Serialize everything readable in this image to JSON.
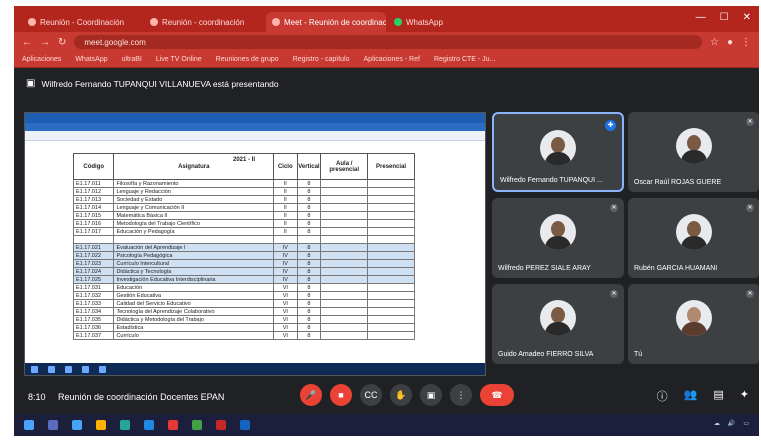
{
  "browser": {
    "tabs": [
      {
        "title": "Reunión - Coordinación",
        "active": false
      },
      {
        "title": "Reunión - coordinación",
        "active": false
      },
      {
        "title": "Meet - Reunión de coordinación",
        "active": true
      },
      {
        "title": "WhatsApp",
        "active": false
      }
    ],
    "url": "meet.google.com",
    "bookmarks": [
      "Aplicaciones",
      "WhatsApp",
      "ultraBI",
      "Live TV Online",
      "Reuniones de grupo",
      "Registro - capítulo",
      "Aplicaciones - Ref",
      "Registro CTE - Ju..."
    ]
  },
  "presenter_text": "Wilfredo Fernando TUPANQUI VILLANUEVA está presentando",
  "shared_doc": {
    "period": "2021 - II",
    "headers": [
      "Código",
      "Asignatura",
      "Ciclo",
      "Vertical",
      "Aula / presencial",
      "Presencial"
    ],
    "rows": [
      {
        "code": "E1.17.011",
        "subject": "Filosofía y Razonamiento",
        "ciclo": "II",
        "val": "8",
        "hl": false
      },
      {
        "code": "E1.17.012",
        "subject": "Lenguaje y Redacción",
        "ciclo": "II",
        "val": "8",
        "hl": false
      },
      {
        "code": "E1.17.013",
        "subject": "Sociedad y Estado",
        "ciclo": "II",
        "val": "8",
        "hl": false
      },
      {
        "code": "E1.17.014",
        "subject": "Lenguaje y Comunicación II",
        "ciclo": "II",
        "val": "8",
        "hl": false
      },
      {
        "code": "E1.17.015",
        "subject": "Matemática Básica II",
        "ciclo": "II",
        "val": "8",
        "hl": false
      },
      {
        "code": "E1.17.016",
        "subject": "Metodología del Trabajo Científico",
        "ciclo": "II",
        "val": "8",
        "hl": false
      },
      {
        "code": "E1.17.017",
        "subject": "Educación y Pedagogía",
        "ciclo": "II",
        "val": "8",
        "hl": false
      },
      {
        "code": "",
        "subject": "",
        "ciclo": "",
        "val": "",
        "hl": false
      },
      {
        "code": "E1.17.021",
        "subject": "Evaluación del Aprendizaje I",
        "ciclo": "IV",
        "val": "8",
        "hl": true
      },
      {
        "code": "E1.17.022",
        "subject": "Psicología Pedagógica",
        "ciclo": "IV",
        "val": "8",
        "hl": true
      },
      {
        "code": "E1.17.023",
        "subject": "Currículo Intercultural",
        "ciclo": "IV",
        "val": "8",
        "hl": true
      },
      {
        "code": "E1.17.024",
        "subject": "Didáctica y Tecnología",
        "ciclo": "IV",
        "val": "8",
        "hl": true
      },
      {
        "code": "E1.17.025",
        "subject": "Investigación Educativa Interdisciplinaria",
        "ciclo": "IV",
        "val": "8",
        "hl": true
      },
      {
        "code": "E1.17.031",
        "subject": "Educación",
        "ciclo": "VI",
        "val": "8",
        "hl": false
      },
      {
        "code": "E1.17.032",
        "subject": "Gestión Educativa",
        "ciclo": "VI",
        "val": "8",
        "hl": false
      },
      {
        "code": "E1.17.033",
        "subject": "Calidad del Servicio Educativo",
        "ciclo": "VI",
        "val": "8",
        "hl": false
      },
      {
        "code": "E1.17.034",
        "subject": "Tecnología del Aprendizaje Colaborativo",
        "ciclo": "VI",
        "val": "8",
        "hl": false
      },
      {
        "code": "E1.17.035",
        "subject": "Didáctica y Metodología del Trabajo",
        "ciclo": "VI",
        "val": "8",
        "hl": false
      },
      {
        "code": "E1.17.036",
        "subject": "Estadística",
        "ciclo": "VI",
        "val": "8",
        "hl": false
      },
      {
        "code": "E1.17.037",
        "subject": "Currículo",
        "ciclo": "VI",
        "val": "8",
        "hl": false
      }
    ]
  },
  "participants": [
    {
      "name": "Wilfredo Fernando TUPANQUI ...",
      "speaking": true
    },
    {
      "name": "Oscar Raúl ROJAS GUERE",
      "speaking": false
    },
    {
      "name": "Wilfredo PEREZ SIALE ARAY",
      "speaking": false
    },
    {
      "name": "Rubén GARCIA HUAMANI",
      "speaking": false
    },
    {
      "name": "Guido Amadeo FIERRO SILVA",
      "speaking": false
    },
    {
      "name": "Tú",
      "speaking": false
    }
  ],
  "meeting": {
    "time": "8:10",
    "name": "Reunión de coordinación Docentes EPAN"
  },
  "colors": {
    "browser_red": "#c83a31",
    "meet_bg": "#202124",
    "end_call": "#ea4335",
    "speaking_border": "#8ab4f8"
  }
}
